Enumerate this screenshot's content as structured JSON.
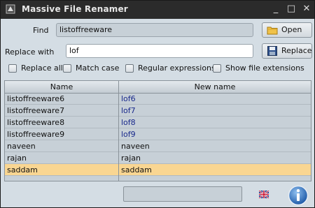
{
  "window": {
    "title": "Massive File Renamer",
    "controls": {
      "minimize": "_",
      "maximize": "□",
      "close": "✕"
    }
  },
  "find": {
    "label": "Find",
    "value": "listoffreeware",
    "open_label": "Open"
  },
  "replace": {
    "label": "Replace with",
    "value": "lof",
    "replace_label": "Replace"
  },
  "options": [
    {
      "label": "Replace all",
      "checked": false
    },
    {
      "label": "Match case",
      "checked": false
    },
    {
      "label": "Regular expressions",
      "checked": false
    },
    {
      "label": "Show file extensions",
      "checked": false
    }
  ],
  "table": {
    "columns": [
      "Name",
      "New name"
    ],
    "rows": [
      {
        "name": "listoffreeware6",
        "new_name": "lof6"
      },
      {
        "name": "listoffreeware7",
        "new_name": "lof7"
      },
      {
        "name": "listoffreeware8",
        "new_name": "lof8"
      },
      {
        "name": "listoffreeware9",
        "new_name": "lof9"
      },
      {
        "name": "naveen",
        "new_name": "naveen"
      },
      {
        "name": "rajan",
        "new_name": "rajan"
      },
      {
        "name": "saddam",
        "new_name": "saddam",
        "selected": true
      }
    ]
  },
  "status": {
    "text": ""
  },
  "colors": {
    "titlebar": "#2b2b2b",
    "selection": "#f9d692",
    "changed_text": "#1a2a8c"
  },
  "icons": [
    "app-icon",
    "folder-icon",
    "save-icon",
    "flag-icon",
    "info-icon"
  ]
}
